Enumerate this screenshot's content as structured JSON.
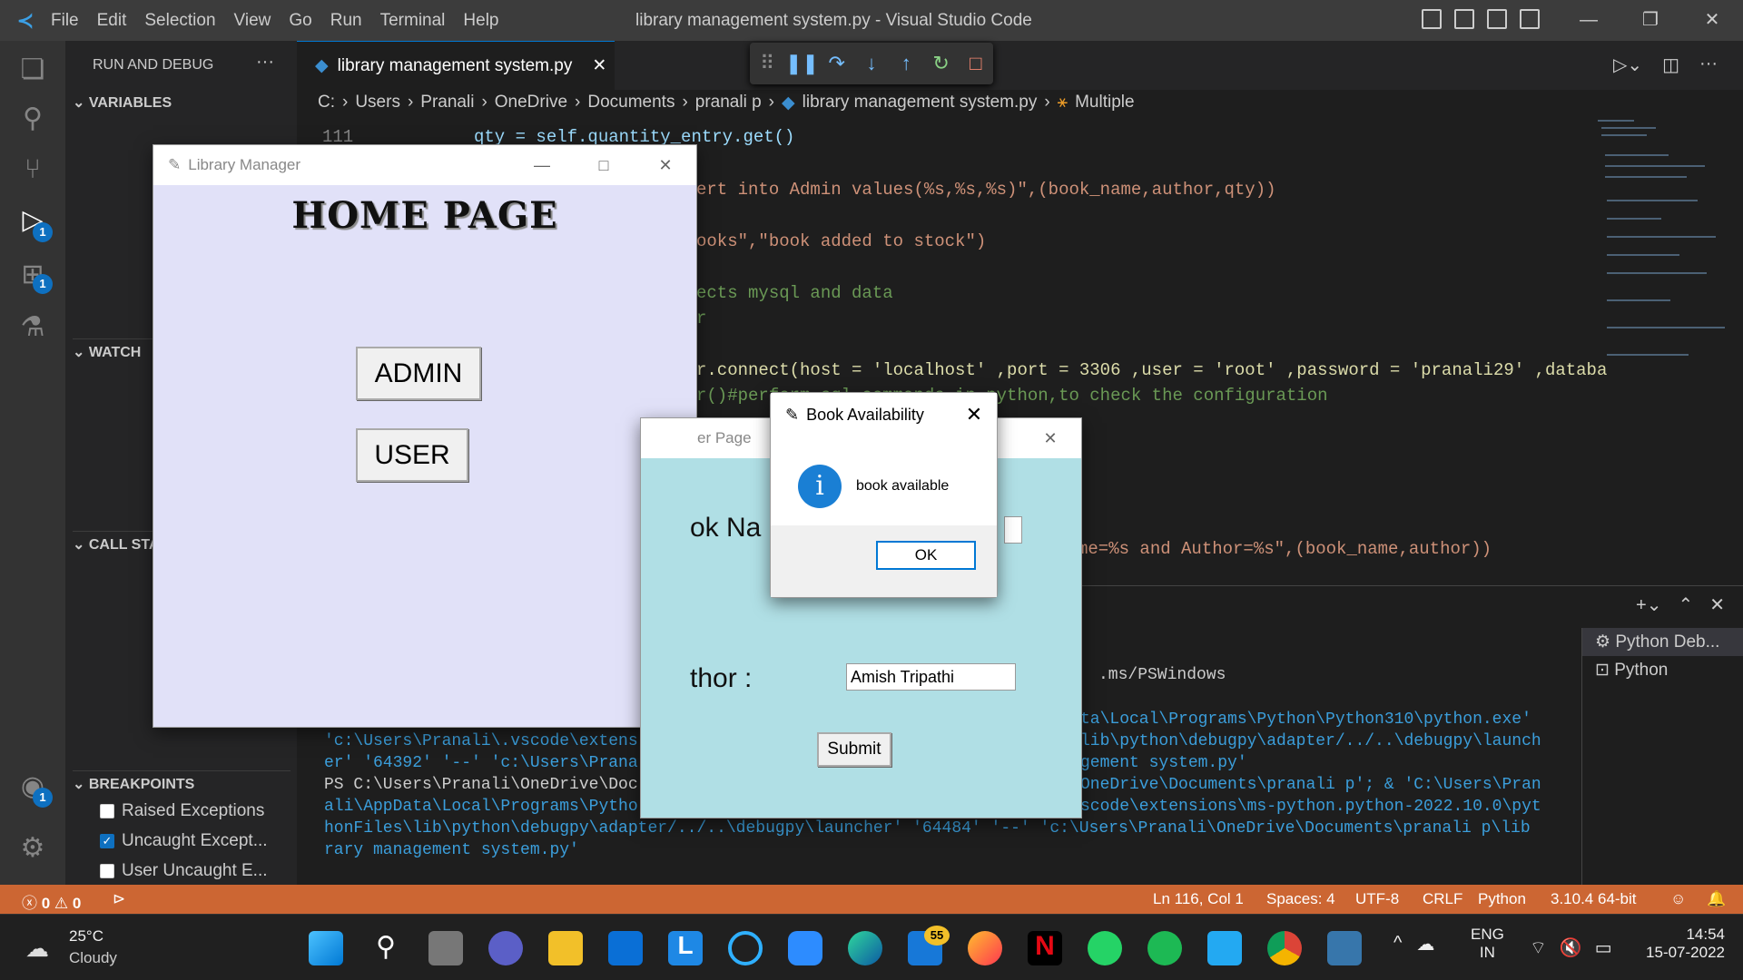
{
  "titlebar": {
    "menu": [
      "File",
      "Edit",
      "Selection",
      "View",
      "Go",
      "Run",
      "Terminal",
      "Help"
    ],
    "title": "library management system.py - Visual Studio Code"
  },
  "sidebar": {
    "header": "RUN AND DEBUG",
    "variables": "VARIABLES",
    "watch": "WATCH",
    "callstack": "CALL STA",
    "breakpoints": "BREAKPOINTS",
    "bp_items": [
      {
        "label": "Raised Exceptions",
        "checked": false
      },
      {
        "label": "Uncaught Except...",
        "checked": true
      },
      {
        "label": "User Uncaught E...",
        "checked": false
      }
    ]
  },
  "badges": {
    "debug": "1",
    "extensions": "1",
    "accounts": "1"
  },
  "tab": {
    "label": "library management system.py"
  },
  "breadcrumb": [
    "C:",
    "Users",
    "Pranali",
    "OneDrive",
    "Documents",
    "pranali p",
    "library management system.py",
    "Multiple"
  ],
  "editor": {
    "line_no": "111",
    "l1": "qty = self.quantity_entry.get()",
    "l2": "ert into Admin values(%s,%s,%s)\",(book_name,author,qty))",
    "l3": "ooks\",\"book added to stock\")",
    "l4": "ects mysql and data",
    "l5": "r",
    "l6": "r.connect(host = 'localhost' ,port = 3306 ,user = 'root' ,password = 'pranali29' ,databa",
    "l7": "r()#perform sql commands in python,to check the configuration",
    "l8": "me=%s and Author=%s\",(book_name,author))"
  },
  "terminal": {
    "t1": ".ms/PSWindows",
    "t2": "ta\\Local\\Programs\\Python\\Python310\\python.exe'",
    "t3a": "'c:\\Users\\Pranali\\.vscode\\extens",
    "t3b": "lib\\python\\debugpy\\adapter/../..\\debugpy\\launch",
    "t4a": "er' '64392' '--' 'c:\\Users\\Prana",
    "t4b": "gement system.py'",
    "t5a": "PS C:\\Users\\Pranali\\OneDrive\\Doc",
    "t5b": "OneDrive\\Documents\\pranali p'; & 'C:\\Users\\Pran",
    "t6a": "ali\\AppData\\Local\\Programs\\Pytho",
    "t6b": "scode\\extensions\\ms-python.python-2022.10.0\\pyt",
    "t7": "honFiles\\lib\\python\\debugpy\\adapter/../..\\debugpy\\launcher' '64484' '--' 'c:\\Users\\Pranali\\OneDrive\\Documents\\pranali p\\lib",
    "t8": "rary management system.py'",
    "list": [
      "Python Deb...",
      "Python"
    ]
  },
  "status": {
    "errors": "0",
    "warnings": "0",
    "position": "Ln 116, Col 1",
    "spaces": "Spaces: 4",
    "encoding": "UTF-8",
    "eol": "CRLF",
    "lang": "Python",
    "interpreter": "3.10.4 64-bit"
  },
  "taskbar": {
    "temp": "25°C",
    "weather": "Cloudy",
    "lang1": "ENG",
    "lang2": "IN",
    "time": "14:54",
    "date": "15-07-2022",
    "notif": "55"
  },
  "libmgr": {
    "title": "Library Manager",
    "heading": "HOME PAGE",
    "admin": "ADMIN",
    "user": "USER"
  },
  "userpage": {
    "title": "er Page",
    "book_label": "ok Na",
    "author_label": "thor :",
    "author_value": "Amish Tripathi",
    "submit": "Submit"
  },
  "dialog": {
    "title": "Book Availability",
    "message": "book available",
    "ok": "OK"
  }
}
